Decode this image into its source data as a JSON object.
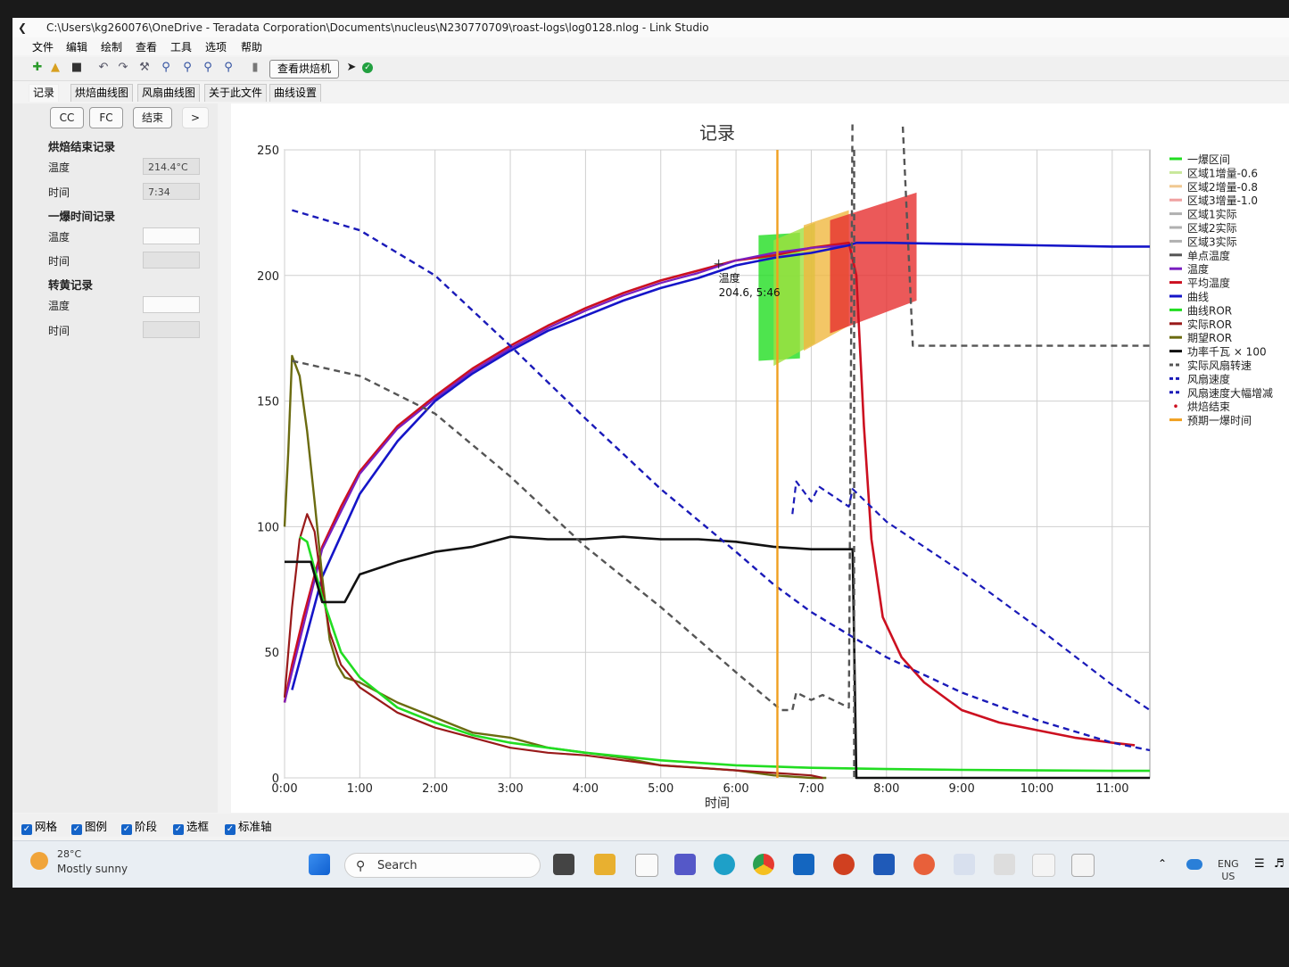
{
  "window": {
    "title": "C:\\Users\\kg260076\\OneDrive - Teradata Corporation\\Documents\\nucleus\\N230770709\\roast-logs\\log0128.nlog - Link Studio"
  },
  "menu": [
    "文件",
    "编辑",
    "绘制",
    "查看",
    "工具",
    "选项",
    "帮助"
  ],
  "toolbar": {
    "icons": [
      "new-file-icon",
      "open-folder-icon",
      "save-icon",
      "undo-icon",
      "redo-icon",
      "wrench-icon",
      "zoom-fit-icon",
      "zoom-in-icon",
      "zoom-out-icon",
      "zoom-reset-icon",
      "usb-icon"
    ],
    "view_roaster": "查看烘焙机",
    "status": "connected"
  },
  "tabs": [
    "记录",
    "烘焙曲线图",
    "风扇曲线图",
    "关于此文件",
    "曲线设置"
  ],
  "left_panel": {
    "buttons": [
      "CC",
      "FC",
      "结束",
      ">"
    ],
    "roast_end": {
      "heading": "烘焙结束记录",
      "temp_label": "温度",
      "temp_value": "214.4°C",
      "time_label": "时间",
      "time_value": "7:34"
    },
    "first_crack": {
      "heading": "一爆时间记录",
      "temp_label": "温度",
      "temp_value": "",
      "time_label": "时间",
      "time_value": ""
    },
    "yellowing": {
      "heading": "转黄记录",
      "temp_label": "温度",
      "temp_value": "",
      "time_label": "时间",
      "time_value": ""
    }
  },
  "bottom_options": [
    "网格",
    "图例",
    "阶段",
    "选框",
    "标准轴"
  ],
  "taskbar": {
    "weather_temp": "28°C",
    "weather_desc": "Mostly sunny",
    "search_placeholder": "Search",
    "lang_1": "ENG",
    "lang_2": "US"
  },
  "chart_data": {
    "type": "line",
    "title": "记录",
    "xlabel": "时间",
    "ylabel": "",
    "xlim": [
      0,
      11.5
    ],
    "ylim": [
      0,
      250
    ],
    "x_ticks": [
      "0:00",
      "1:00",
      "2:00",
      "3:00",
      "4:00",
      "5:00",
      "6:00",
      "7:00",
      "8:00",
      "9:00",
      "10:00",
      "11:00"
    ],
    "y_ticks": [
      "0",
      "50",
      "100",
      "150",
      "200",
      "250"
    ],
    "grid": true,
    "legend_position": "right",
    "tooltip": {
      "label": "温度",
      "value": "204.6, 5:46",
      "x": 5.77,
      "y": 204.6
    },
    "expected_first_crack_min": 6.55,
    "roast_end_min": 7.57,
    "legend": [
      {
        "name": "一爆区间",
        "color": "#22dd22",
        "style": "solid"
      },
      {
        "name": "区域1增量-0.6",
        "color": "#c8e89a",
        "style": "solid"
      },
      {
        "name": "区域2增量-0.8",
        "color": "#f0c890",
        "style": "solid"
      },
      {
        "name": "区域3增量-1.0",
        "color": "#f0a0a0",
        "style": "solid"
      },
      {
        "name": "区域1实际",
        "color": "#b0b0b0",
        "style": "solid"
      },
      {
        "name": "区域2实际",
        "color": "#b0b0b0",
        "style": "solid"
      },
      {
        "name": "区域3实际",
        "color": "#b0b0b0",
        "style": "solid"
      },
      {
        "name": "单点温度",
        "color": "#555555",
        "style": "solid"
      },
      {
        "name": "温度",
        "color": "#7a1fc0",
        "style": "solid"
      },
      {
        "name": "平均温度",
        "color": "#cc1020",
        "style": "solid"
      },
      {
        "name": "曲线",
        "color": "#1515c8",
        "style": "solid"
      },
      {
        "name": "曲线ROR",
        "color": "#22dd22",
        "style": "solid"
      },
      {
        "name": "实际ROR",
        "color": "#991a1a",
        "style": "solid"
      },
      {
        "name": "期望ROR",
        "color": "#6b6b10",
        "style": "solid"
      },
      {
        "name": "功率千瓦 × 100",
        "color": "#111111",
        "style": "solid"
      },
      {
        "name": "实际风扇转速",
        "color": "#555555",
        "style": "dashed"
      },
      {
        "name": "风扇速度",
        "color": "#1a1ab8",
        "style": "dashed"
      },
      {
        "name": "风扇速度大幅增减",
        "color": "#1a1ab8",
        "style": "dashed"
      },
      {
        "name": "烘焙结束",
        "color": "#cc1020",
        "style": "dot"
      },
      {
        "name": "预期一爆时间",
        "color": "#f0a020",
        "style": "solid"
      }
    ],
    "zones": [
      {
        "name": "一爆区间",
        "color": "#22dd22",
        "x": [
          6.3,
          6.85
        ],
        "y_low": [
          166,
          167
        ],
        "y_high": [
          216,
          217
        ]
      },
      {
        "name": "区域1增量-0.6",
        "color": "#a0e040",
        "x": [
          6.5,
          7.05
        ],
        "y_low": [
          164,
          173
        ],
        "y_high": [
          214,
          221
        ]
      },
      {
        "name": "区域2增量-0.8",
        "color": "#f0b840",
        "x": [
          6.9,
          7.5
        ],
        "y_low": [
          170,
          180
        ],
        "y_high": [
          220,
          226
        ]
      },
      {
        "name": "区域3增量-1.0",
        "color": "#e63030",
        "x": [
          7.25,
          8.4
        ],
        "y_low": [
          177,
          190
        ],
        "y_high": [
          222,
          233
        ]
      }
    ],
    "series": [
      {
        "name": "平均温度",
        "color": "#cc1020",
        "x": [
          0,
          0.1,
          0.25,
          0.5,
          0.75,
          1.0,
          1.5,
          2.0,
          2.5,
          3.0,
          3.5,
          4.0,
          4.5,
          5.0,
          5.5,
          6.0,
          6.5,
          7.0,
          7.5,
          7.6,
          7.7,
          7.8,
          7.95,
          8.2,
          8.5,
          9.0,
          9.5,
          10.0,
          10.5,
          11.0,
          11.3
        ],
        "y": [
          30,
          45,
          64,
          92,
          108,
          122,
          140,
          152,
          163,
          172,
          180,
          187,
          193,
          198,
          202,
          206,
          208,
          211,
          213,
          200,
          140,
          95,
          64,
          48,
          38,
          27,
          22,
          19,
          16,
          14,
          13
        ]
      },
      {
        "name": "温度",
        "color": "#7a1fc0",
        "x": [
          0,
          0.5,
          1.0,
          1.5,
          2.0,
          2.5,
          3.0,
          3.5,
          4.0,
          4.5,
          5.0,
          5.5,
          6.0,
          6.5,
          7.0,
          7.5
        ],
        "y": [
          30,
          91,
          121,
          139,
          151,
          162,
          171,
          179,
          186,
          192,
          197,
          201,
          206,
          209,
          211,
          212
        ]
      },
      {
        "name": "曲线",
        "color": "#1515c8",
        "x": [
          0.1,
          0.5,
          1.0,
          1.5,
          2.0,
          2.5,
          3.0,
          3.5,
          4.0,
          4.5,
          5.0,
          5.5,
          6.0,
          6.5,
          7.0,
          7.5,
          7.6,
          8.0,
          9.0,
          10.0,
          11.0,
          11.5
        ],
        "y": [
          35,
          80,
          113,
          134,
          150,
          161,
          170,
          178,
          184,
          190,
          195,
          199,
          204,
          207,
          209,
          212,
          213,
          213,
          212.5,
          212,
          211.5,
          211.5
        ]
      },
      {
        "name": "期望ROR",
        "color": "#6b6b10",
        "x": [
          0,
          0.05,
          0.1,
          0.2,
          0.3,
          0.4,
          0.5,
          0.6,
          0.7,
          0.8,
          1.0,
          1.5,
          2.0,
          2.5,
          3.0,
          3.5,
          4.0,
          4.5,
          5.0,
          5.5,
          6.0,
          6.5,
          7.0,
          7.2
        ],
        "y": [
          100,
          130,
          168,
          160,
          138,
          110,
          80,
          55,
          45,
          40,
          38,
          30,
          24,
          18,
          16,
          12,
          10,
          8,
          5,
          4,
          3,
          1,
          0,
          0
        ]
      },
      {
        "name": "实际ROR",
        "color": "#991a1a",
        "x": [
          0,
          0.1,
          0.2,
          0.3,
          0.4,
          0.5,
          0.6,
          0.75,
          1.0,
          1.5,
          2.0,
          2.5,
          3.0,
          3.5,
          4.0,
          4.5,
          5.0,
          5.5,
          6.0,
          6.5,
          7.0,
          7.15
        ],
        "y": [
          32,
          68,
          95,
          105,
          98,
          75,
          58,
          45,
          36,
          26,
          20,
          16,
          12,
          10,
          9,
          7,
          5,
          4,
          3,
          2,
          1,
          0
        ]
      },
      {
        "name": "曲线ROR",
        "color": "#22dd22",
        "x": [
          0.2,
          0.3,
          0.5,
          0.75,
          1.0,
          1.5,
          2.0,
          2.5,
          3.0,
          3.5,
          4.0,
          5.0,
          6.0,
          7.0,
          8.0,
          9.0,
          10.0,
          11.0,
          11.5
        ],
        "y": [
          96,
          94,
          72,
          50,
          40,
          28,
          22,
          17,
          14,
          12,
          10,
          7,
          5,
          4,
          3.5,
          3.2,
          3,
          2.8,
          2.8
        ]
      },
      {
        "name": "功率千瓦 × 100",
        "color": "#111111",
        "x": [
          0,
          0.35,
          0.5,
          0.8,
          1.0,
          1.5,
          2.0,
          2.5,
          3.0,
          3.5,
          4.0,
          4.5,
          5.0,
          5.5,
          6.0,
          6.5,
          7.0,
          7.5,
          7.55,
          7.6,
          11.5
        ],
        "y": [
          86,
          86,
          70,
          70,
          81,
          86,
          90,
          92,
          96,
          95,
          95,
          96,
          95,
          95,
          94,
          92,
          91,
          91,
          91,
          0,
          0
        ]
      },
      {
        "name": "实际风扇转速",
        "color": "#555555",
        "x": [
          0.1,
          1.0,
          2.0,
          3.0,
          4.0,
          5.0,
          6.0,
          6.6,
          6.75,
          6.8,
          7.0,
          7.15,
          7.5,
          7.55,
          8.2,
          8.35,
          9.0,
          10.0,
          11.0,
          11.5
        ],
        "y": [
          166,
          160,
          145,
          120,
          92,
          68,
          42,
          27,
          27,
          34,
          31,
          33,
          28,
          270,
          270,
          172,
          172,
          172,
          172,
          172
        ]
      },
      {
        "name": "风扇速度",
        "color": "#1a1ab8",
        "x": [
          0.1,
          1.0,
          2.0,
          3.0,
          4.0,
          5.0,
          6.0,
          6.5,
          7.0,
          7.5,
          8.0,
          9.0,
          10.0,
          11.0,
          11.5
        ],
        "y": [
          226,
          218,
          200,
          172,
          143,
          115,
          90,
          77,
          66,
          57,
          48,
          34,
          23,
          14,
          11
        ]
      },
      {
        "name": "风扇速度大幅增减",
        "color": "#1a1ab8",
        "x": [
          6.75,
          6.8,
          7.0,
          7.1,
          7.5,
          7.55,
          8.0,
          9.0,
          10.0,
          11.0,
          11.5
        ],
        "y": [
          105,
          118,
          110,
          116,
          108,
          115,
          102,
          82,
          60,
          37,
          27
        ]
      }
    ]
  }
}
